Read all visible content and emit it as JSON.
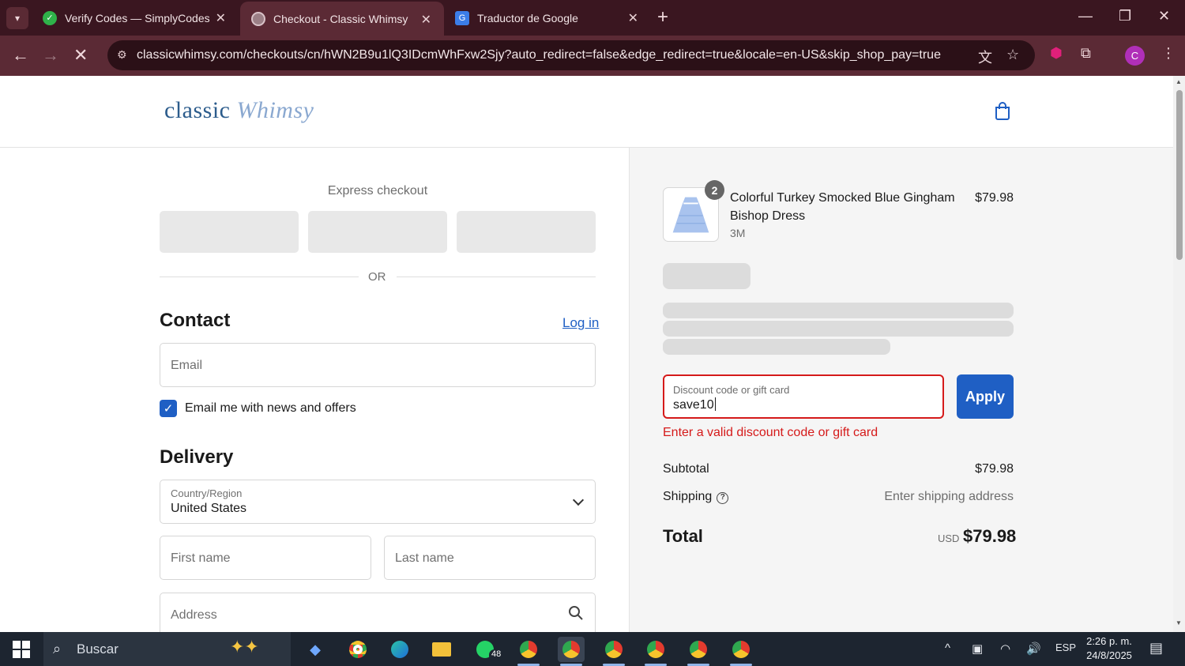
{
  "browser": {
    "tabs": [
      {
        "title": "Verify Codes — SimplyCodes"
      },
      {
        "title": "Checkout - Classic Whimsy"
      },
      {
        "title": "Traductor de Google"
      }
    ],
    "url": "classicwhimsy.com/checkouts/cn/hWN2B9u1lQ3IDcmWhFxw2Sjy?auto_redirect=false&edge_redirect=true&locale=en-US&skip_shop_pay=true",
    "profile_initial": "C"
  },
  "header": {
    "logo_main": "classic",
    "logo_script": "Whimsy"
  },
  "express": {
    "title": "Express checkout",
    "or_label": "OR"
  },
  "contact": {
    "heading": "Contact",
    "login_label": "Log in",
    "email_placeholder": "Email",
    "newsletter_label": "Email me with news and offers",
    "newsletter_checked": true
  },
  "delivery": {
    "heading": "Delivery",
    "country_label": "Country/Region",
    "country_value": "United States",
    "first_name_placeholder": "First name",
    "last_name_placeholder": "Last name",
    "address_placeholder": "Address"
  },
  "summary": {
    "product": {
      "name": "Colorful Turkey Smocked Blue Gingham Bishop Dress",
      "variant": "3M",
      "price": "$79.98",
      "quantity": "2"
    },
    "discount": {
      "label": "Discount code or gift card",
      "value": "save10",
      "apply_label": "Apply",
      "error": "Enter a valid discount code or gift card"
    },
    "subtotal_label": "Subtotal",
    "subtotal_value": "$79.98",
    "shipping_label": "Shipping",
    "shipping_value": "Enter shipping address",
    "total_label": "Total",
    "total_currency": "USD",
    "total_value": "$79.98"
  },
  "taskbar": {
    "search_label": "Buscar",
    "whatsapp_badge": "48",
    "language": "ESP",
    "time": "2:26 p. m.",
    "date": "24/8/2025"
  },
  "colors": {
    "accent": "#1f5fc4",
    "error": "#d51a1a",
    "browser_frame": "#5b2a35"
  }
}
